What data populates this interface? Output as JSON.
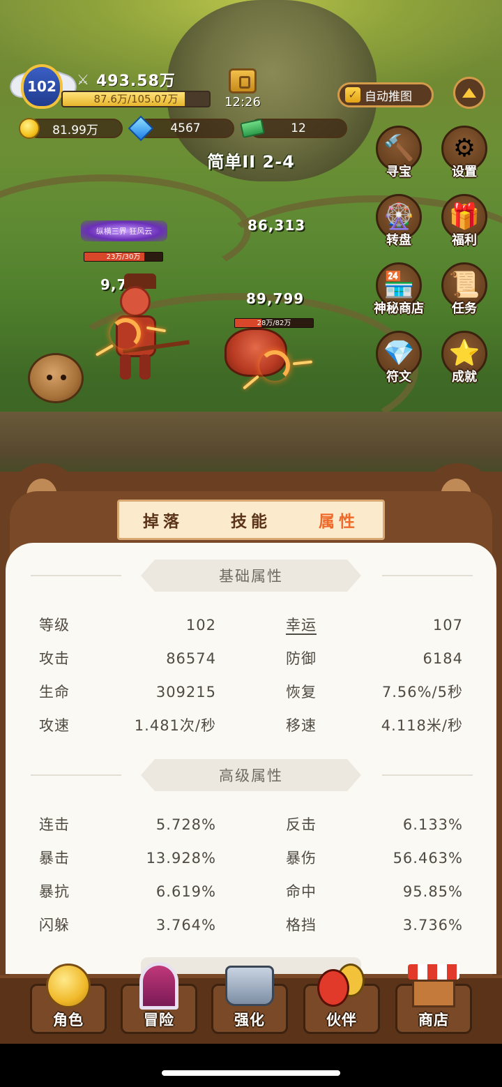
{
  "player": {
    "level": "102",
    "power": "493.58万",
    "exp_text": "87.6万/105.07万",
    "exp_fraction": 0.834,
    "timer": "12:26"
  },
  "resources": {
    "gold": "81.99万",
    "diamond": "4567",
    "cash": "12"
  },
  "auto_push_label": "自动推图",
  "stage": "简单II 2-4",
  "side_menu": [
    {
      "label": "寻宝",
      "icon": "hammer-icon"
    },
    {
      "label": "设置",
      "icon": "gear-icon"
    },
    {
      "label": "转盘",
      "icon": "wheel-icon"
    },
    {
      "label": "福利",
      "icon": "gift-icon"
    },
    {
      "label": "神秘商店",
      "icon": "shop-stall-icon"
    },
    {
      "label": "任务",
      "icon": "scroll-icon"
    },
    {
      "label": "符文",
      "icon": "crystal-icon"
    },
    {
      "label": "成就",
      "icon": "star-icon"
    }
  ],
  "battle": {
    "guild_name": "纵横三界  狂风云",
    "hero_hp_text": "23万/30万",
    "hero_hp_fraction": 0.767,
    "hero_damage": "9,777",
    "enemy_hp_text": "28万/82万",
    "enemy_hp_fraction": 0.341,
    "enemy_damage": "89,799",
    "floating_damage": "86,313"
  },
  "tabs": [
    {
      "label": "掉落",
      "active": false
    },
    {
      "label": "技能",
      "active": false
    },
    {
      "label": "属性",
      "active": true
    }
  ],
  "basic_title": "基础属性",
  "basic_stats": [
    {
      "l_key": "等级",
      "l_val": "102",
      "r_key": "幸运",
      "r_val": "107"
    },
    {
      "l_key": "攻击",
      "l_val": "86574",
      "r_key": "防御",
      "r_val": "6184"
    },
    {
      "l_key": "生命",
      "l_val": "309215",
      "r_key": "恢复",
      "r_val": "7.56%/5秒"
    },
    {
      "l_key": "攻速",
      "l_val": "1.481次/秒",
      "r_key": "移速",
      "r_val": "4.118米/秒"
    }
  ],
  "advanced_title": "高级属性",
  "advanced_stats": [
    {
      "l_key": "连击",
      "l_val": "5.728%",
      "r_key": "反击",
      "r_val": "6.133%"
    },
    {
      "l_key": "暴击",
      "l_val": "13.928%",
      "r_key": "暴伤",
      "r_val": "56.463%"
    },
    {
      "l_key": "暴抗",
      "l_val": "6.619%",
      "r_key": "命中",
      "r_val": "95.85%"
    },
    {
      "l_key": "闪躲",
      "l_val": "3.764%",
      "r_key": "格挡",
      "r_val": "3.736%"
    }
  ],
  "bottom_nav": [
    {
      "label": "角色",
      "icon": "role-icon"
    },
    {
      "label": "冒险",
      "icon": "portal-icon"
    },
    {
      "label": "强化",
      "icon": "anvil-icon"
    },
    {
      "label": "伙伴",
      "icon": "partner-icon"
    },
    {
      "label": "商店",
      "icon": "shop-icon"
    }
  ]
}
